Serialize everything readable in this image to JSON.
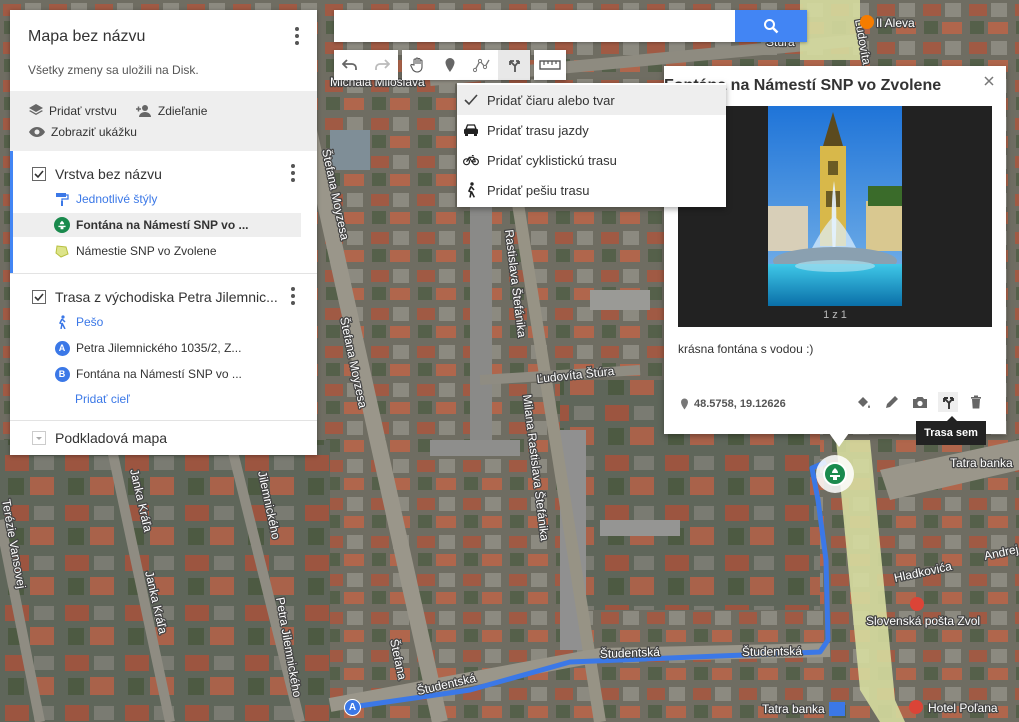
{
  "panel": {
    "map_title": "Mapa bez názvu",
    "save_status": "Všetky zmeny sa uložili na Disk.",
    "actions": {
      "add_layer": "Pridať vrstvu",
      "share": "Zdieľanie",
      "preview": "Zobraziť ukážku"
    },
    "layer1": {
      "title": "Vrstva bez názvu",
      "style_link": "Jednotlivé štýly",
      "items": [
        {
          "label": "Fontána na Námestí SNP vo ...",
          "icon": "fountain-icon"
        },
        {
          "label": "Námestie SNP vo Zvolene",
          "icon": "polygon-icon"
        }
      ]
    },
    "layer2": {
      "title": "Trasa z východiska Petra Jilemnic...",
      "mode": "Pešo",
      "waypoints": [
        {
          "badge": "A",
          "label": "Petra Jilemnického 1035/2, Z..."
        },
        {
          "badge": "B",
          "label": "Fontána na Námestí SNP vo ..."
        }
      ],
      "add_destination": "Pridať cieľ"
    },
    "basemap": "Podkladová mapa"
  },
  "search": {
    "value": "",
    "placeholder": ""
  },
  "toolbar": {
    "buttons": [
      "undo-icon",
      "redo-icon",
      "hand-icon",
      "marker-icon",
      "line-icon",
      "directions-icon",
      "ruler-icon"
    ]
  },
  "dropdown": {
    "items": [
      {
        "label": "Pridať čiaru alebo tvar",
        "icon": "check-icon"
      },
      {
        "label": "Pridať trasu jazdy",
        "icon": "car-icon"
      },
      {
        "label": "Pridať cyklistickú trasu",
        "icon": "bicycle-icon"
      },
      {
        "label": "Pridať pešiu trasu",
        "icon": "walk-icon"
      }
    ]
  },
  "info": {
    "title": "Fontána na Námestí SNP vo Zvolene",
    "photo_counter": "1 z 1",
    "description": "krásna fontána s vodou :)",
    "coords": "48.5758, 19.12626",
    "tooltip": "Trasa sem"
  },
  "map": {
    "streets": [
      "Michala Miloslava",
      "Štefana Moyzesa",
      "Štefana Moyzesa",
      "Milana Rastislava Štefánika",
      "Rastislava Štefánika",
      "Ľudovíta Štúra",
      "Študentská",
      "Študentská",
      "Študentská",
      "Petra Jilemnického",
      "Jilemnického",
      "Janka Kráľa",
      "Janka Kráľa",
      "Terézie Vansovej",
      "Štefana",
      "Hladkovića",
      "Andrej",
      "Ľudovíta Štúra",
      "Štúra"
    ],
    "pois": [
      {
        "label": "Tatra banka",
        "icon": "bank-icon"
      },
      {
        "label": "Slovenská pošta Zvol",
        "icon": "mail-icon"
      },
      {
        "label": "Tatra banka",
        "icon": "atm-icon"
      },
      {
        "label": "Hotel Poľana",
        "icon": "hotel-icon"
      },
      {
        "label": "Il Aleva",
        "icon": "restaurant-icon"
      }
    ],
    "marker_a": "A"
  },
  "colors": {
    "accent": "#4285f4",
    "route": "#3b78e7",
    "fountain": "#1a8a4d"
  }
}
